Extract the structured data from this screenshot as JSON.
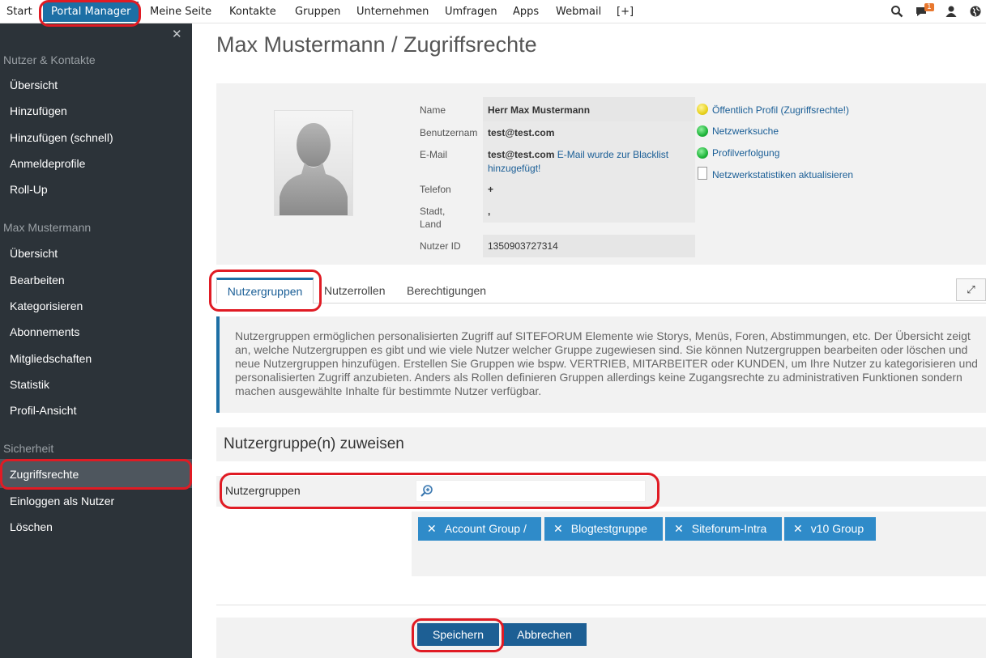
{
  "topnav": {
    "items": [
      "Start",
      "Portal Manager",
      "Meine Seite",
      "Kontakte",
      "Gruppen",
      "Unternehmen",
      "Umfragen",
      "Apps",
      "Webmail",
      "[+]"
    ],
    "notification_count": "1",
    "icons": [
      "search-icon",
      "chat-icon",
      "user-icon",
      "globe-icon"
    ]
  },
  "sidebar": {
    "close": "✕",
    "section1": "Nutzer & Kontakte",
    "section1_items": [
      "Übersicht",
      "Hinzufügen",
      "Hinzufügen (schnell)",
      "Anmeldeprofile",
      "Roll-Up"
    ],
    "section2": "Max Mustermann",
    "section2_items": [
      "Übersicht",
      "Bearbeiten",
      "Kategorisieren",
      "Abonnements",
      "Mitgliedschaften",
      "Statistik",
      "Profil-Ansicht"
    ],
    "section3": "Sicherheit",
    "section3_items": [
      "Zugriffsrechte",
      "Einloggen als Nutzer",
      "Löschen"
    ]
  },
  "main": {
    "title": "Max Mustermann / Zugriffsrechte",
    "profile": {
      "labels": {
        "name": "Name",
        "username": "Benutzernam",
        "email": "E-Mail",
        "phone": "Telefon",
        "city_1": "Stadt,",
        "city_2": "Land",
        "user_id": "Nutzer ID"
      },
      "values": {
        "name": "Herr Max Mustermann",
        "username": "test@test.com",
        "email": "test@test.com",
        "email_note_1": "E-Mail wurde zur Blacklist",
        "email_note_2": "hinzugefügt!",
        "phone": "+",
        "city": ",",
        "user_id": "1350903727314"
      },
      "status_links": [
        "Öffentlich Profil (Zugriffsrechte!)",
        "Netzwerksuche",
        "Profilverfolgung",
        "Netzwerkstatistiken aktualisieren"
      ],
      "status_colors": [
        "#e8d21e",
        "#1fb53a",
        "#1fb53a"
      ]
    },
    "tabs": [
      "Nutzergruppen",
      "Nutzerrollen",
      "Berechtigungen"
    ],
    "expand_icon": "⤢",
    "info_text": "Nutzergruppen ermöglichen personalisierten Zugriff auf SITEFORUM Elemente wie Storys, Menüs, Foren, Abstimmungen, etc. Der Übersicht zeigt an, welche Nutzergruppen es gibt und wie viele Nutzer welcher Gruppe zugewiesen sind. Sie können Nutzergruppen bearbeiten oder löschen und neue Nutzergruppen hinzufügen. Erstellen Sie Gruppen wie bspw. VERTRIEB, MITARBEITER oder KUNDEN, um Ihre Nutzer zu kategorisieren und personalisierten Zugriff anzubieten. Anders als Rollen definieren Gruppen allerdings keine Zugangsrechte zu administrativen Funktionen sondern machen ausgewählte Inhalte für bestimmte Nutzer verfügbar.",
    "assign_heading": "Nutzergruppe(n) zuweisen",
    "field_label": "Nutzergruppen",
    "search_value": "",
    "tags": [
      "Account Group /",
      "Blogtestgruppe",
      "Siteforum-Intra",
      "v10 Group"
    ],
    "tag_remove": "✕",
    "buttons": {
      "save": "Speichern",
      "cancel": "Abbrechen"
    }
  },
  "colors": {
    "accent": "#1d6fa5",
    "sidebar_bg": "#2c3339",
    "annotation": "#e01b24"
  }
}
